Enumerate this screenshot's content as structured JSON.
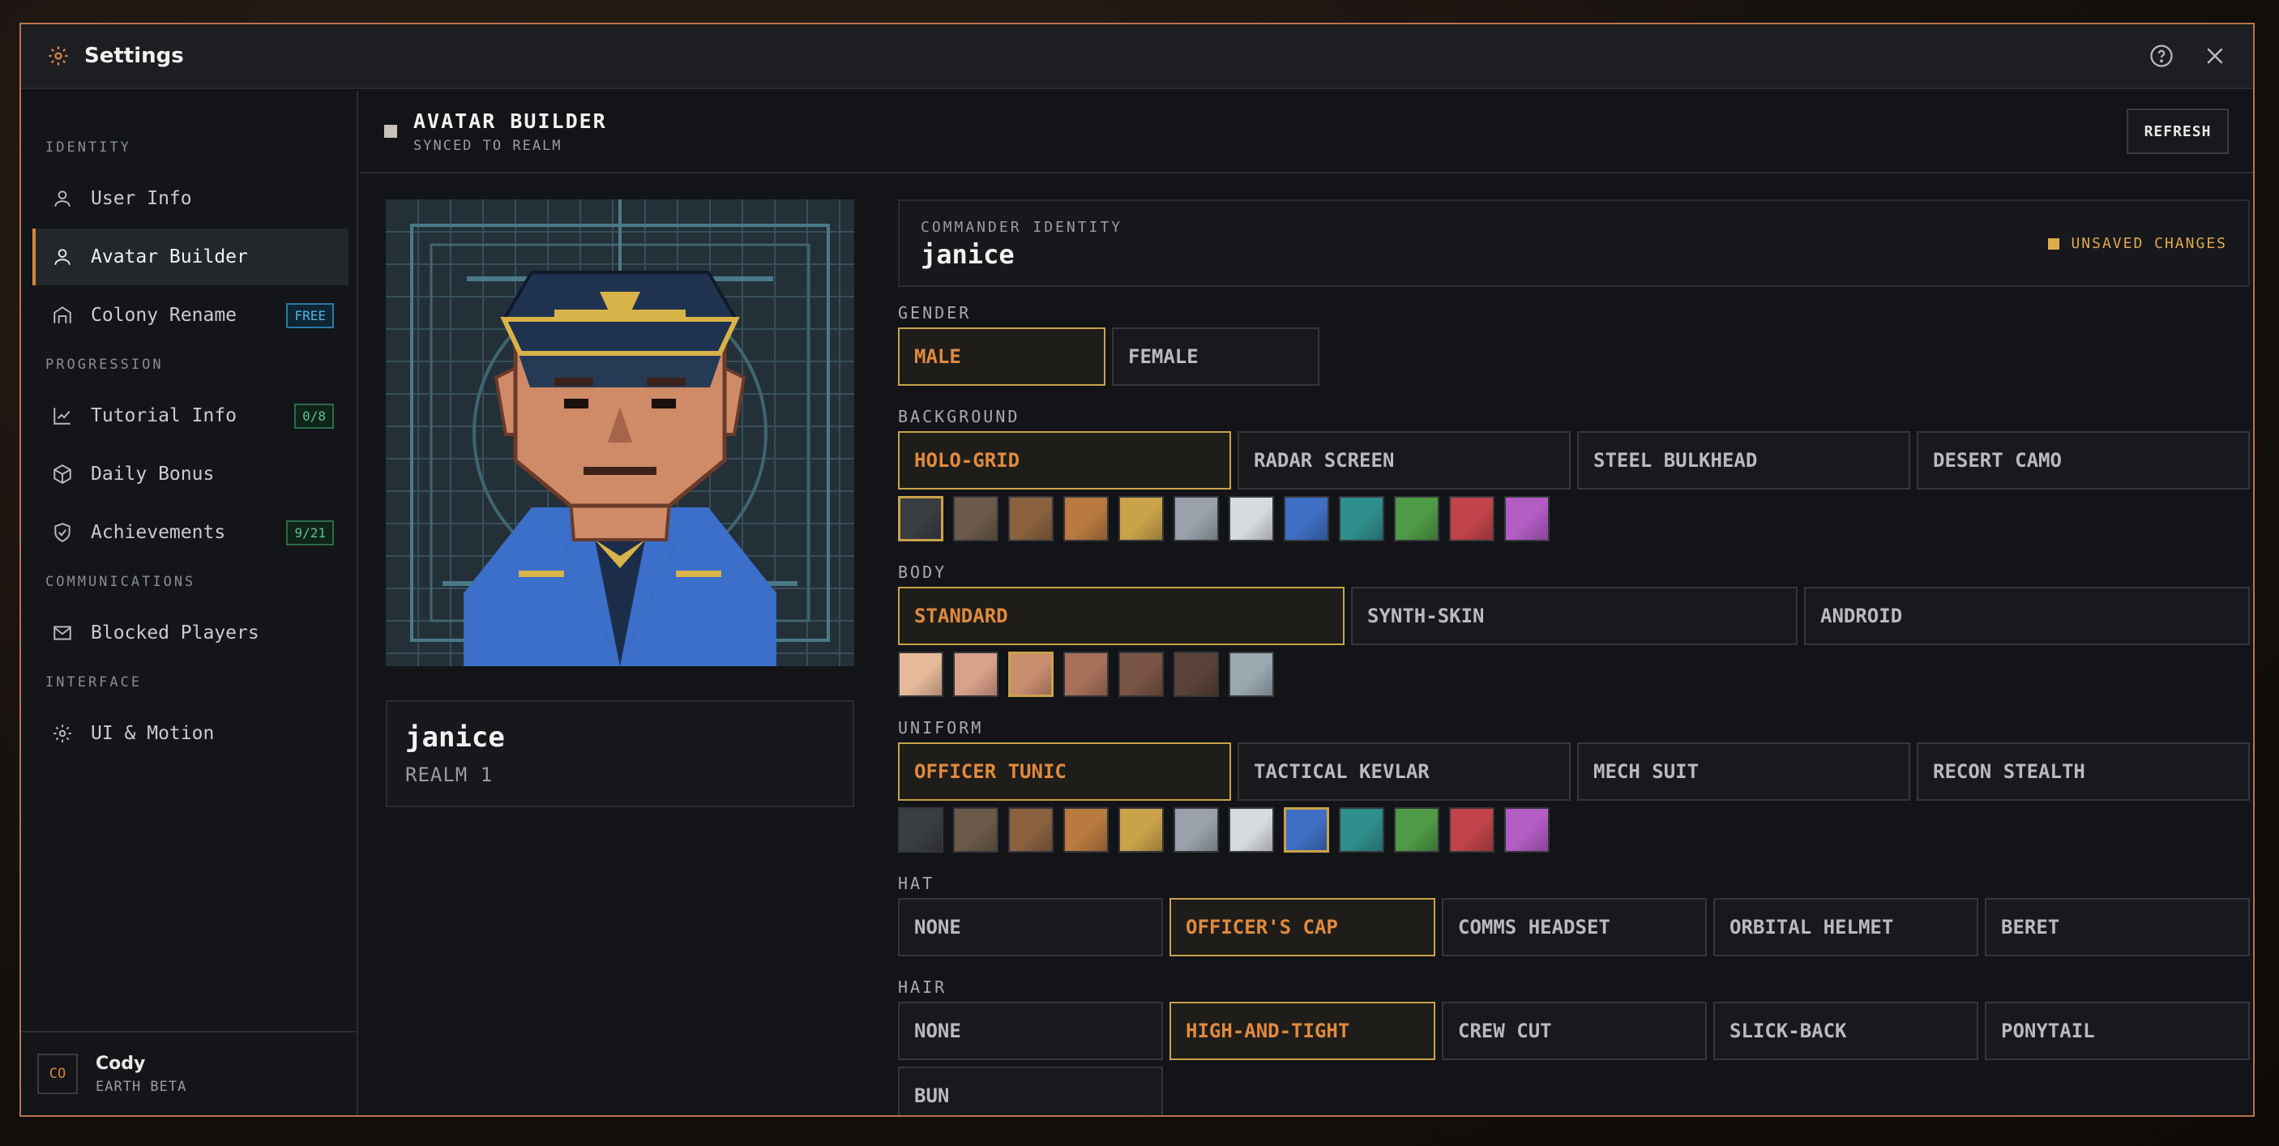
{
  "window": {
    "title": "Settings"
  },
  "sidebar": {
    "sections": [
      {
        "label": "IDENTITY"
      },
      {
        "label": "PROGRESSION"
      },
      {
        "label": "COMMUNICATIONS"
      },
      {
        "label": "INTERFACE"
      }
    ],
    "items": [
      {
        "label": "User Info",
        "icon": "user-icon"
      },
      {
        "label": "Avatar Builder",
        "icon": "user-icon",
        "active": true
      },
      {
        "label": "Colony Rename",
        "icon": "building-icon",
        "badge": "FREE"
      },
      {
        "label": "Tutorial Info",
        "icon": "chart-icon",
        "badge": "0/8"
      },
      {
        "label": "Daily Bonus",
        "icon": "cube-icon"
      },
      {
        "label": "Achievements",
        "icon": "shield-icon",
        "badge": "9/21"
      },
      {
        "label": "Blocked Players",
        "icon": "mail-icon"
      },
      {
        "label": "UI & Motion",
        "icon": "gear-icon"
      }
    ],
    "user": {
      "initials": "CO",
      "name": "Cody",
      "realm": "EARTH BETA"
    }
  },
  "header": {
    "title": "AVATAR BUILDER",
    "subtitle": "SYNCED TO REALM",
    "refresh_label": "REFRESH"
  },
  "preview": {
    "name": "janice",
    "realm": "REALM 1"
  },
  "identity": {
    "label": "COMMANDER IDENTITY",
    "value": "janice",
    "status": "UNSAVED CHANGES"
  },
  "groups": {
    "gender": {
      "label": "GENDER",
      "options": [
        "MALE",
        "FEMALE"
      ],
      "selected": "MALE"
    },
    "background": {
      "label": "BACKGROUND",
      "options": [
        "HOLO-GRID",
        "RADAR SCREEN",
        "STEEL BULKHEAD",
        "DESERT CAMO"
      ],
      "selected": "HOLO-GRID"
    },
    "body": {
      "label": "BODY",
      "options": [
        "STANDARD",
        "SYNTH-SKIN",
        "ANDROID"
      ],
      "selected": "STANDARD"
    },
    "uniform": {
      "label": "UNIFORM",
      "options": [
        "OFFICER TUNIC",
        "TACTICAL KEVLAR",
        "MECH SUIT",
        "RECON STEALTH"
      ],
      "selected": "OFFICER TUNIC"
    },
    "hat": {
      "label": "HAT",
      "options": [
        "NONE",
        "OFFICER'S CAP",
        "COMMS HEADSET",
        "ORBITAL HELMET",
        "BERET"
      ],
      "selected": "OFFICER'S CAP"
    },
    "hair": {
      "label": "HAIR",
      "options": [
        "NONE",
        "HIGH-AND-TIGHT",
        "CREW CUT",
        "SLICK-BACK",
        "PONYTAIL",
        "BUN"
      ],
      "selected": "HIGH-AND-TIGHT"
    }
  },
  "palettes": {
    "background": {
      "colors": [
        "#3a3d42",
        "#6b5a4a",
        "#8a6240",
        "#b87a3e",
        "#c9a24a",
        "#9aa1ab",
        "#d8dbde",
        "#3f6fc4",
        "#2f8f8c",
        "#4f9a46",
        "#c2444a",
        "#b25cc4"
      ],
      "selected_index": 0
    },
    "body": {
      "colors": [
        "#e6b99a",
        "#d9a08a",
        "#c98e70",
        "#a8705a",
        "#7a5444",
        "#5a4238",
        "#9aa8b0"
      ],
      "selected_index": 2
    },
    "uniform": {
      "colors": [
        "#3a3d42",
        "#6b5a4a",
        "#8a6240",
        "#b87a3e",
        "#c9a24a",
        "#9aa1ab",
        "#d8dbde",
        "#3f6fc4",
        "#2f8f8c",
        "#4f9a46",
        "#c2444a",
        "#b25cc4"
      ],
      "selected_index": 7
    }
  },
  "colors": {
    "accent": "#d9843f",
    "border_accent": "#b8734a",
    "selected_border": "#c9a24a"
  }
}
